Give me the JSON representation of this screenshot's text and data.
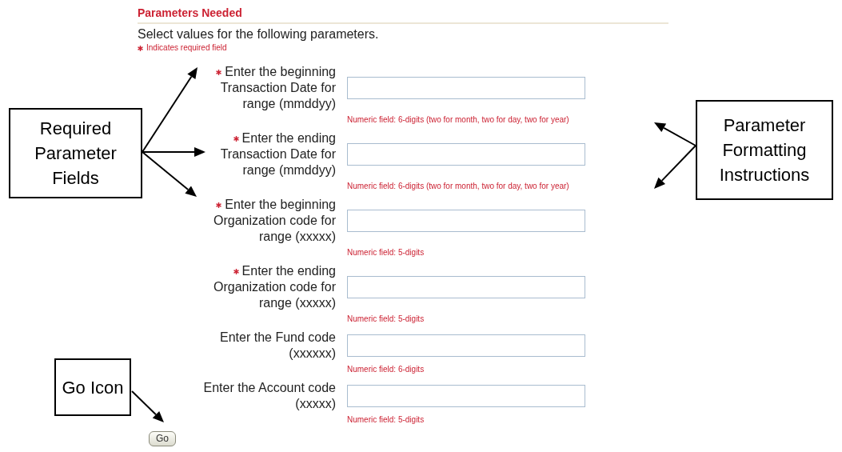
{
  "header": {
    "title": "Parameters Needed",
    "instruction": "Select values for the following parameters.",
    "required_note": "Indicates required field"
  },
  "parameters": [
    {
      "label": "Enter the beginning Transaction Date for range (mmddyy)",
      "required": true,
      "hint": "Numeric field: 6-digits (two for month, two for day, two for year)"
    },
    {
      "label": "Enter the ending Transaction Date for range (mmddyy)",
      "required": true,
      "hint": "Numeric field: 6-digits (two for month, two for day, two for year)"
    },
    {
      "label": "Enter the beginning Organization code for range (xxxxx)",
      "required": true,
      "hint": "Numeric field: 5-digits"
    },
    {
      "label": "Enter the ending Organization code for range (xxxxx)",
      "required": true,
      "hint": "Numeric field: 5-digits"
    },
    {
      "label": "Enter the Fund code (xxxxxx)",
      "required": false,
      "hint": "Numeric field: 6-digits"
    },
    {
      "label": "Enter the Account code (xxxxx)",
      "required": false,
      "hint": "Numeric field: 5-digits"
    }
  ],
  "go_button": "Go",
  "annotations": [
    {
      "text": "Required Parameter Fields"
    },
    {
      "text": "Parameter Formatting Instructions"
    },
    {
      "text": "Go Icon"
    }
  ]
}
